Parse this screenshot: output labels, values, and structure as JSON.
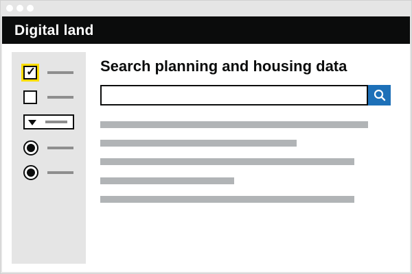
{
  "window": {
    "title": "Digital land",
    "controls": [
      "window-dot",
      "window-dot",
      "window-dot"
    ]
  },
  "page": {
    "heading": "Search planning and housing data"
  },
  "search": {
    "value": "",
    "placeholder": "",
    "button_icon": "search-icon",
    "button_color": "#1d70b8"
  },
  "sidebar": {
    "filters": [
      {
        "type": "checkbox",
        "checked": true,
        "focused": true,
        "icon": "checkmark-icon"
      },
      {
        "type": "checkbox",
        "checked": false
      },
      {
        "type": "select",
        "icon": "dropdown-arrow-icon"
      },
      {
        "type": "radio",
        "selected": true
      },
      {
        "type": "radio",
        "selected": true
      }
    ]
  },
  "results": {
    "count": 5
  },
  "colors": {
    "header_bg": "#0b0c0c",
    "focus": "#ffdd00",
    "placeholder_line": "#b1b4b6",
    "sidebar_bg": "#e5e5e5"
  }
}
